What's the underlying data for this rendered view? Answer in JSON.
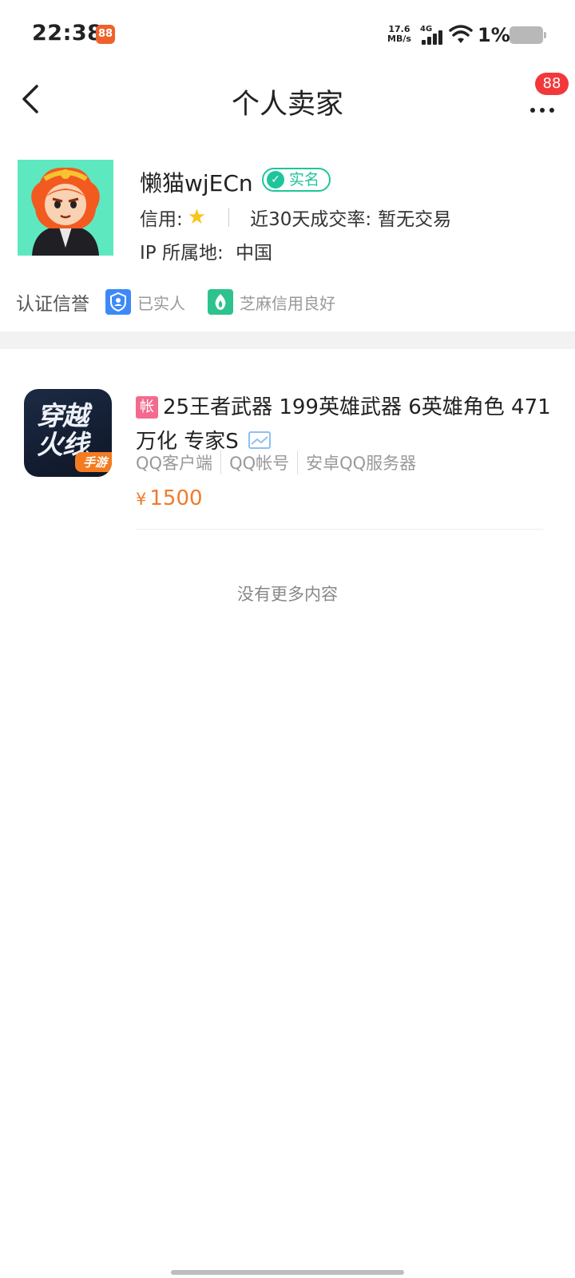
{
  "status_bar": {
    "time": "22:38",
    "app_icon_glyph": "88",
    "net_speed_value": "17.6",
    "net_speed_unit": "MB/s",
    "network_type": "4G",
    "battery_percent": "1%",
    "icons": [
      "signal-icon",
      "wifi-icon",
      "battery-icon"
    ]
  },
  "nav": {
    "title": "个人卖家",
    "notification_count": "88",
    "icons": [
      "back-arrow-icon",
      "more-dots-icon"
    ]
  },
  "seller": {
    "name": "懒猫wjECn",
    "verified_label": "实名",
    "credit_label": "信用:",
    "credit_stars": 1,
    "trade_rate_label": "近30天成交率:",
    "trade_rate_value": "暂无交易",
    "ip_label": "IP 所属地:",
    "ip_value": "中国"
  },
  "certifications": {
    "label": "认证信誉",
    "items": [
      {
        "text": "已实人",
        "icon": "person-shield-icon",
        "color": "#3d8af7"
      },
      {
        "text": "芝麻信用良好",
        "icon": "sesame-credit-icon",
        "color": "#2ec28e"
      }
    ]
  },
  "listing": {
    "account_tag": "帐",
    "title": "25王者武器 199英雄武器 6英雄角色 471万化 专家S",
    "game_icon_text_line1": "穿越",
    "game_icon_text_line2": "火线",
    "game_icon_tag": "手游",
    "meta": [
      "QQ客户端",
      "QQ帐号",
      "安卓QQ服务器"
    ],
    "currency": "¥",
    "price": "1500"
  },
  "footer": {
    "no_more_text": "没有更多内容"
  },
  "colors": {
    "accent_green": "#1fc59a",
    "price_orange": "#f07b2c",
    "badge_red": "#f2383a",
    "tag_pink": "#f46a8e"
  }
}
